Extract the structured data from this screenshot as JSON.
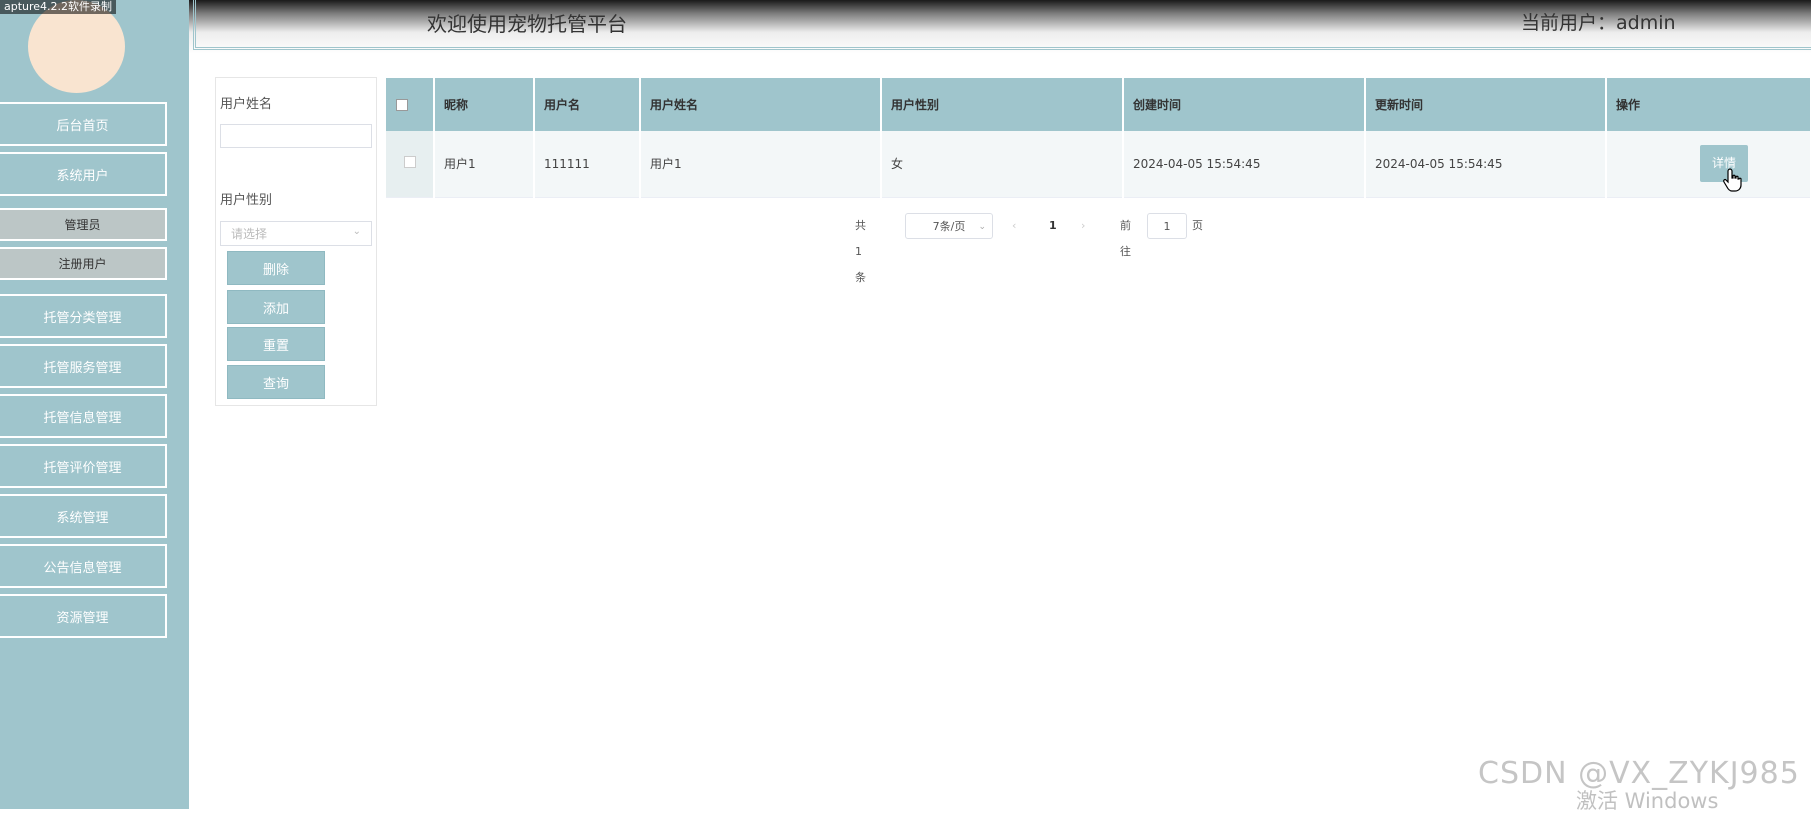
{
  "capture_label": "apture4.2.2软件录制",
  "header": {
    "title": "欢迎使用宠物托管平台",
    "current_user": "当前用户：admin"
  },
  "sidebar": {
    "items": [
      {
        "label": "后台首页"
      },
      {
        "label": "系统用户"
      },
      {
        "label": "管理员"
      },
      {
        "label": "注册用户"
      },
      {
        "label": "托管分类管理"
      },
      {
        "label": "托管服务管理"
      },
      {
        "label": "托管信息管理"
      },
      {
        "label": "托管评价管理"
      },
      {
        "label": "系统管理"
      },
      {
        "label": "公告信息管理"
      },
      {
        "label": "资源管理"
      }
    ]
  },
  "filters": {
    "name_label": "用户姓名",
    "name_value": "",
    "gender_label": "用户性别",
    "gender_placeholder": "请选择",
    "buttons": {
      "delete": "删除",
      "add": "添加",
      "reset": "重置",
      "search": "查询"
    }
  },
  "table": {
    "columns": [
      "昵称",
      "用户名",
      "用户姓名",
      "用户性别",
      "创建时间",
      "更新时间",
      "操作"
    ],
    "rows": [
      {
        "nickname": "用户1",
        "username": "111111",
        "realname": "用户1",
        "gender": "女",
        "created": "2024-04-05 15:54:45",
        "updated": "2024-04-05 15:54:45",
        "action": "详情"
      }
    ]
  },
  "pagination": {
    "total": "共 1 条",
    "page_size": "7条/页",
    "current_page": "1",
    "goto_label": "前往",
    "goto_value": "1",
    "goto_suffix": "页"
  },
  "overlay": {
    "watermark": "CSDN @VX_ZYKJ985",
    "windows_activation": "激活 Windows"
  },
  "colors": {
    "accent": "#9fc5cc",
    "avatar": "#f9e4d0",
    "submenu": "#bcc6c6"
  },
  "icons": {
    "cursor": "hand-pointer-icon",
    "select_arrow": "chevron-down-icon"
  }
}
